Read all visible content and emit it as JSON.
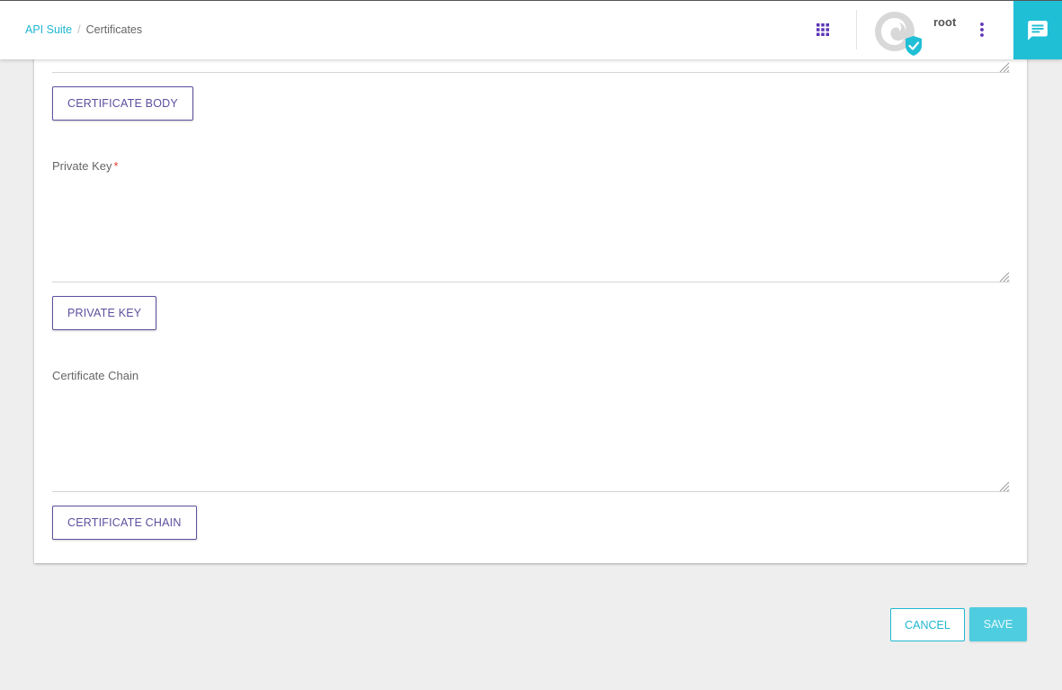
{
  "header": {
    "breadcrumb": {
      "root": "API Suite",
      "separator": "/",
      "current": "Certificates"
    },
    "apps_icon": "apps-grid-icon",
    "user": {
      "name": "root",
      "verified_icon": "verified-check-icon"
    },
    "more_icon": "more-vert-icon",
    "chat_icon": "chat-icon",
    "accent_color": "#1fbfd6",
    "icon_color": "#5c35b5"
  },
  "form": {
    "certificate_body": {
      "upload_button": "CERTIFICATE BODY",
      "value": ""
    },
    "private_key": {
      "label": "Private Key",
      "required_mark": "*",
      "value": "",
      "upload_button": "PRIVATE KEY"
    },
    "certificate_chain": {
      "label": "Certificate Chain",
      "value": "",
      "upload_button": "CERTIFICATE CHAIN"
    }
  },
  "actions": {
    "cancel": "CANCEL",
    "save": "SAVE"
  }
}
